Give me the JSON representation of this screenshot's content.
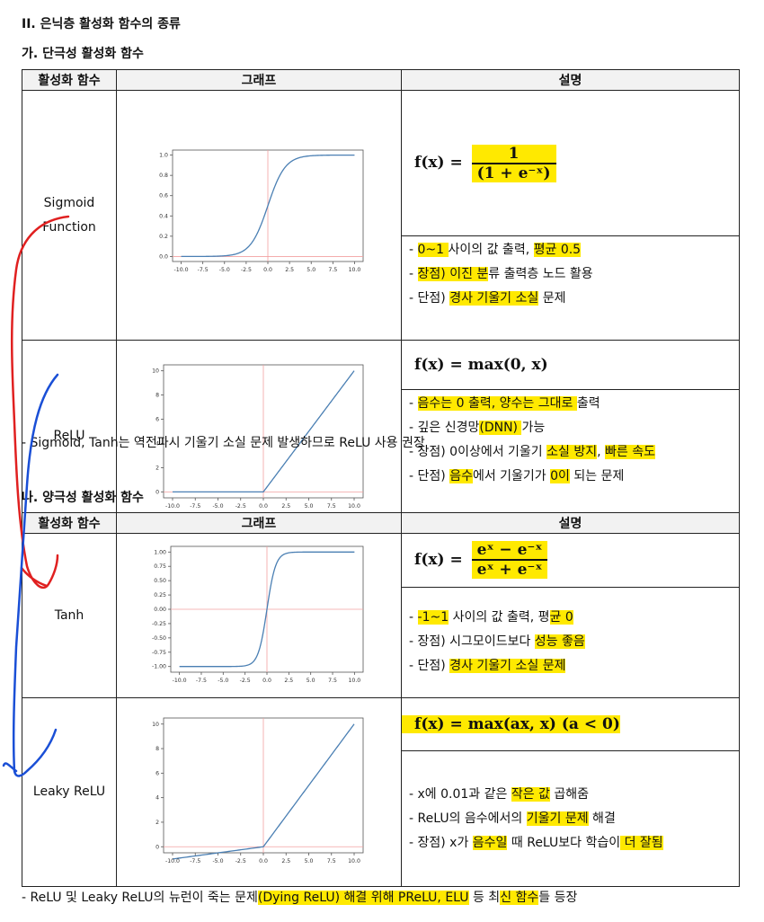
{
  "section_title": "II. 은닉층 활성화 함수의 종류",
  "sub1": {
    "title": "가. 단극성 활성화 함수",
    "headers": [
      "활성화 함수",
      "그래프",
      "설명"
    ],
    "rows": [
      {
        "name_lines": [
          "Sigmoid",
          "Function"
        ],
        "formula": {
          "lhs": "f(x) =",
          "num": "1",
          "den": "(1 + e⁻ˣ)"
        },
        "desc": [
          [
            {
              "t": "- "
            },
            {
              "t": "0~1 ",
              "hl": true
            },
            {
              "t": "사이의 값 출력, "
            },
            {
              "t": "평균 0.5",
              "hl": true
            }
          ],
          [
            {
              "t": "- "
            },
            {
              "t": "장점) ",
              "hl": true
            },
            {
              "t": "이진 분",
              "hl": true
            },
            {
              "t": "류 출력층 노드 활용"
            }
          ],
          [
            {
              "t": "- 단점) "
            },
            {
              "t": "경사 기울기 소실",
              "hl": true
            },
            {
              "t": " 문제"
            }
          ]
        ],
        "graph": {
          "xticks": [
            "-10.0",
            "-7.5",
            "-5.0",
            "-2.5",
            "0.0",
            "2.5",
            "5.0",
            "7.5",
            "10.0"
          ],
          "yticks": [
            "0.0",
            "0.2",
            "0.4",
            "0.6",
            "0.8",
            "1.0"
          ]
        }
      },
      {
        "name_lines": [
          "ReLU"
        ],
        "formula": {
          "text": "f(x) = max(0, x)"
        },
        "desc": [
          [
            {
              "t": "- "
            },
            {
              "t": "음수는 0 출력, 양수는 그대로 ",
              "hl": true
            },
            {
              "t": "출력"
            }
          ],
          [
            {
              "t": "- 깊은 신경망"
            },
            {
              "t": "(DNN) ",
              "hl": true
            },
            {
              "t": "가능"
            }
          ],
          [
            {
              "t": "- 장점) 0이상에서 기울기 "
            },
            {
              "t": "소실 방지",
              "hl": true
            },
            {
              "t": ", "
            },
            {
              "t": "빠른 속도",
              "hl": true
            }
          ],
          [
            {
              "t": "- 단점) "
            },
            {
              "t": "음수",
              "hl": true
            },
            {
              "t": "에서 기울기가 "
            },
            {
              "t": "0이",
              "hl": true
            },
            {
              "t": " 되는 문제"
            }
          ]
        ],
        "graph": {
          "xticks": [
            "-10.0",
            "-7.5",
            "-5.0",
            "-2.5",
            "0.0",
            "2.5",
            "5.0",
            "7.5",
            "10.0"
          ],
          "yticks": [
            "0",
            "2",
            "4",
            "6",
            "8",
            "10"
          ]
        }
      }
    ],
    "note": "- Sigmoid, Tanh는 역전파시 기울기 소실 문제 발생하므로 ReLU 사용 권장"
  },
  "sub2": {
    "title": "나. 양극성 활성화 함수",
    "headers": [
      "활성화 함수",
      "그래프",
      "설명"
    ],
    "rows": [
      {
        "name_lines": [
          "Tanh"
        ],
        "formula": {
          "lhs": "f(x) =",
          "num": "eˣ − e⁻ˣ",
          "den": "eˣ + e⁻ˣ"
        },
        "desc": [
          [
            {
              "t": "- "
            },
            {
              "t": "-1~1",
              "hl": true
            },
            {
              "t": " 사이의 값 출력, 평"
            },
            {
              "t": "균 0",
              "hl": true
            }
          ],
          [
            {
              "t": "- 장점) 시그모이드보다 "
            },
            {
              "t": "성능 좋음",
              "hl": true
            }
          ],
          [
            {
              "t": "- 단점) "
            },
            {
              "t": "경사 기울기 소실 문제",
              "hl": true
            }
          ]
        ],
        "graph": {
          "xticks": [
            "-10.0",
            "-7.5",
            "-5.0",
            "-2.5",
            "0.0",
            "2.5",
            "5.0",
            "7.5",
            "10.0"
          ],
          "yticks": [
            "-1.00",
            "-0.75",
            "-0.50",
            "-0.25",
            "0.00",
            "0.25",
            "0.50",
            "0.75",
            "1.00"
          ]
        }
      },
      {
        "name_lines": [
          "Leaky ReLU"
        ],
        "formula": {
          "text": "f(x) = max(ax, x)  (a < 0)"
        },
        "desc": [
          [
            {
              "t": "- x에 0.01과 같은 "
            },
            {
              "t": "작은 값",
              "hl": true
            },
            {
              "t": " 곱해줌"
            }
          ],
          [
            {
              "t": "- ReLU의 음수에서의 "
            },
            {
              "t": "기울기 문제",
              "hl": true
            },
            {
              "t": " 해결"
            }
          ],
          [
            {
              "t": "- 장점) x가 "
            },
            {
              "t": "음수일",
              "hl": true
            },
            {
              "t": " 때 ReLU보다 학습이"
            },
            {
              "t": " 더 잘됨",
              "hl": true
            }
          ]
        ],
        "graph": {
          "xticks": [
            "-10.0",
            "-7.5",
            "-5.0",
            "-2.5",
            "0.0",
            "2.5",
            "5.0",
            "7.5",
            "10.0"
          ],
          "yticks": [
            "0",
            "2",
            "4",
            "6",
            "8",
            "10"
          ]
        }
      }
    ],
    "note_parts": [
      {
        "t": "- ReLU 및 Leaky ReLU의 뉴런이 죽는 문제"
      },
      {
        "t": "(Dying ReLU) 해결 위해 ",
        "hl": true
      },
      {
        "t": "PReLU, ELU",
        "hl": true
      },
      {
        "t": " 등 최"
      },
      {
        "t": "신 함수",
        "hl": true
      },
      {
        "t": "들 등장"
      }
    ]
  },
  "colors": {
    "highlight": "#ffe900",
    "curve": "#4a7fb3",
    "axisline": "#f2a0a0",
    "red_pen": "#e02020",
    "blue_pen": "#1a4fd6"
  }
}
